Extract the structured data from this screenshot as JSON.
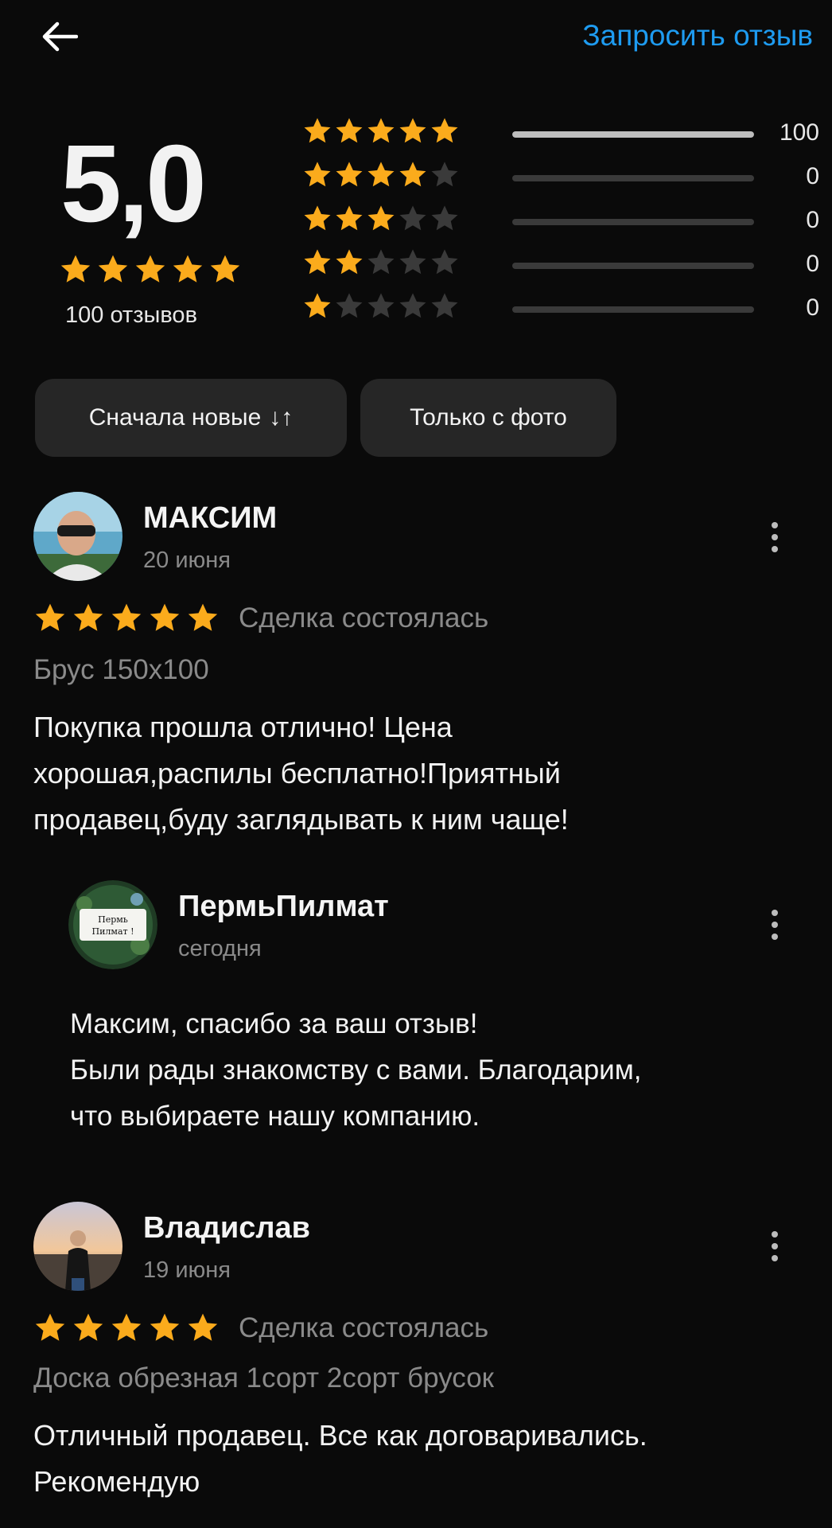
{
  "header": {
    "request_review_label": "Запросить отзыв"
  },
  "summary": {
    "average": "5,0",
    "average_stars": 5,
    "reviews_count_label": "100 отзывов",
    "distribution": [
      {
        "stars": 5,
        "count": "100",
        "fraction": 1.0
      },
      {
        "stars": 4,
        "count": "0",
        "fraction": 0
      },
      {
        "stars": 3,
        "count": "0",
        "fraction": 0
      },
      {
        "stars": 2,
        "count": "0",
        "fraction": 0
      },
      {
        "stars": 1,
        "count": "0",
        "fraction": 0
      }
    ]
  },
  "filters": {
    "sort_label": "Сначала новые",
    "sort_icon": "↓↑",
    "photo_label": "Только с фото"
  },
  "reviews": [
    {
      "author": "МАКСИМ",
      "date": "20 июня",
      "stars": 5,
      "deal_status": "Сделка состоялась",
      "product": "Брус 150х100",
      "text_lines": [
        "Покупка прошла отлично! Цена",
        "хорошая,распилы бесплатно!Приятный",
        "продавец,буду заглядывать к ним чаще!"
      ],
      "reply": {
        "author": "ПермьПилмат",
        "date": "сегодня",
        "avatar_text": "Пермь Пилмат !",
        "text_lines": [
          "Максим, спасибо за ваш отзыв!",
          "Были рады знакомству с вами. Благодарим,",
          "что выбираете нашу компанию."
        ]
      }
    },
    {
      "author": "Владислав",
      "date": "19 июня",
      "stars": 5,
      "deal_status": "Сделка состоялась",
      "product": "Доска обрезная 1сорт 2сорт брусок",
      "text_lines": [
        "Отличный продавец. Все как договаривались.",
        "Рекомендую"
      ]
    }
  ],
  "colors": {
    "accent": "#1e9bf0",
    "star": "#fbab1c",
    "star_empty": "#3a3a3a",
    "muted_text": "#8a8a8a"
  },
  "icons": [
    "back-arrow-icon",
    "star-icon",
    "sort-icon",
    "more-vertical-icon"
  ]
}
